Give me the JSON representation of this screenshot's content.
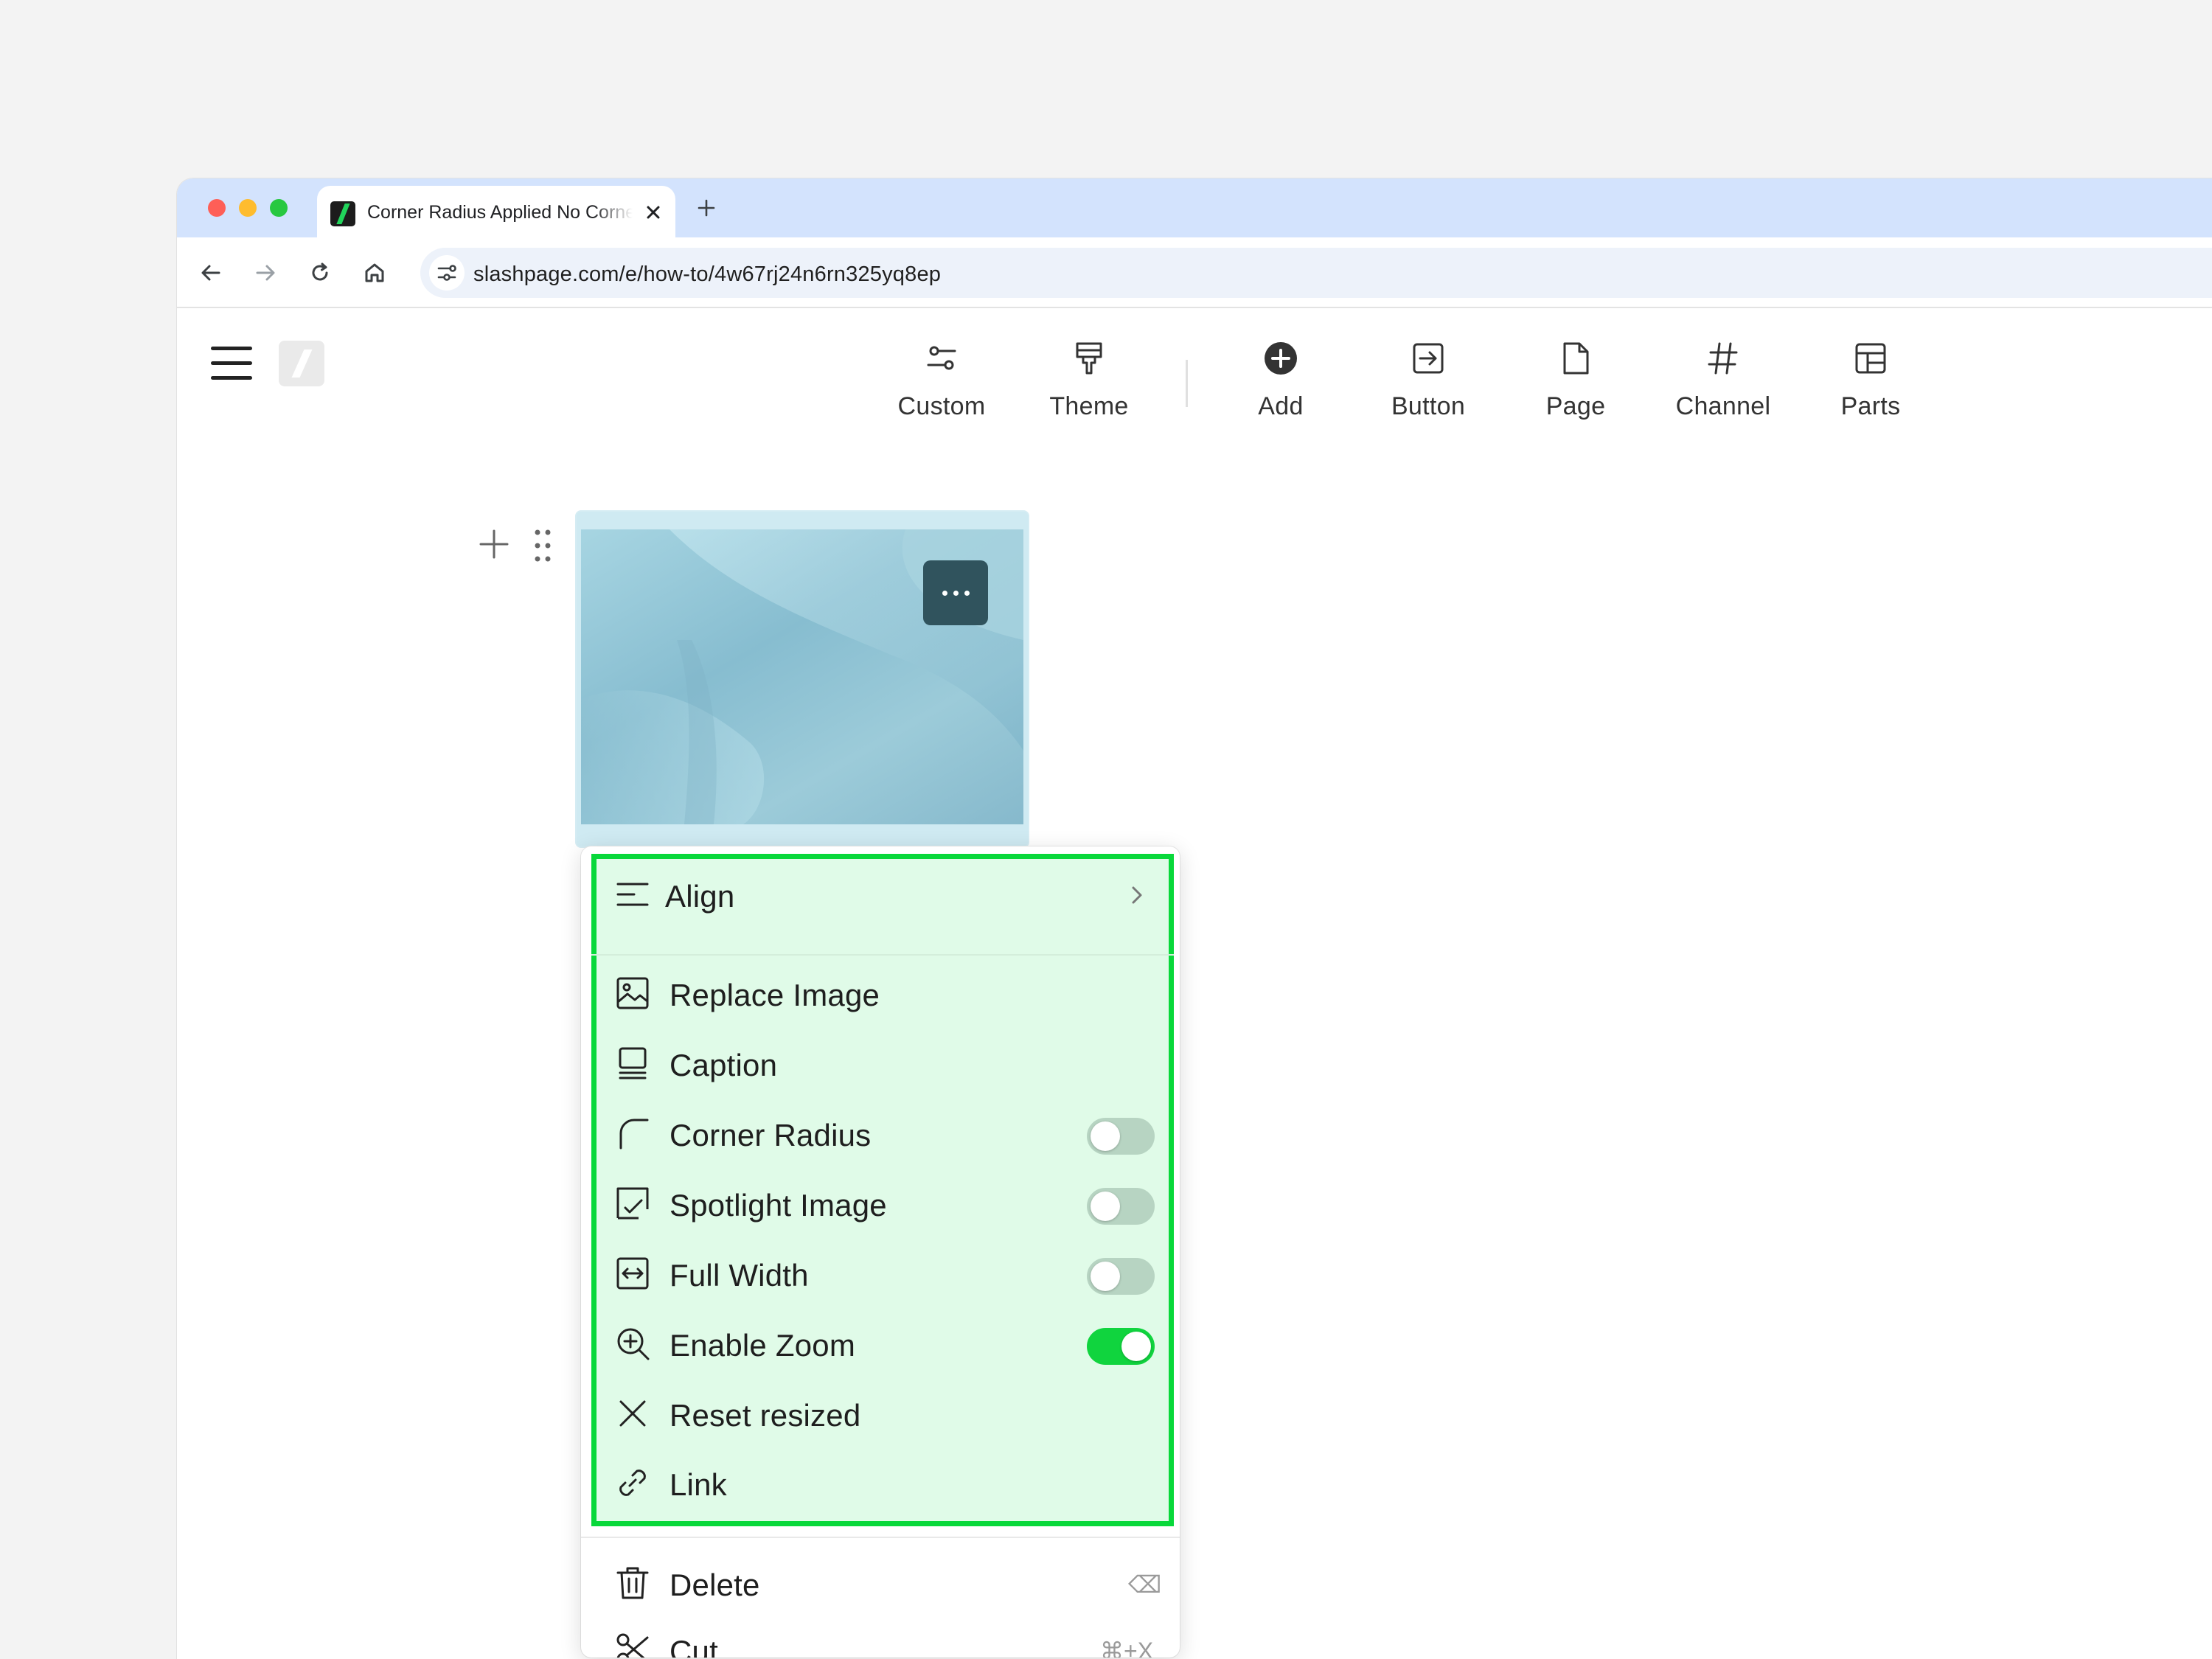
{
  "browser": {
    "tab_title": "Corner Radius Applied No Corner Radius",
    "url": "slashpage.com/e/how-to/4w67rj24n6rn325yq8ep",
    "traffic_light_colors": [
      "#fe5f57",
      "#febc2e",
      "#28c840"
    ]
  },
  "toolbar": {
    "items": [
      {
        "label": "Custom",
        "icon": "sliders-icon"
      },
      {
        "label": "Theme",
        "icon": "paint-roller-icon"
      },
      {
        "label": "Add",
        "icon": "plus-circle-icon"
      },
      {
        "label": "Button",
        "icon": "enter-box-icon"
      },
      {
        "label": "Page",
        "icon": "page-icon"
      },
      {
        "label": "Channel",
        "icon": "hash-icon"
      },
      {
        "label": "Parts",
        "icon": "layout-icon"
      }
    ]
  },
  "menu": {
    "align": "Align",
    "items": [
      {
        "label": "Replace Image",
        "icon": "image-icon"
      },
      {
        "label": "Caption",
        "icon": "caption-icon"
      },
      {
        "label": "Corner Radius",
        "icon": "corner-radius-icon",
        "toggle": false
      },
      {
        "label": "Spotlight Image",
        "icon": "spotlight-icon",
        "toggle": false
      },
      {
        "label": "Full Width",
        "icon": "full-width-icon",
        "toggle": false
      },
      {
        "label": "Enable Zoom",
        "icon": "zoom-in-icon",
        "toggle": true
      },
      {
        "label": "Reset resized",
        "icon": "close-icon"
      },
      {
        "label": "Link",
        "icon": "link-icon"
      }
    ],
    "delete": "Delete",
    "delete_shortcut": "⌫",
    "cut": "Cut",
    "cut_shortcut": "⌘+X"
  },
  "colors": {
    "highlight_border": "#08d83a",
    "highlight_fill": "#e0fbe8",
    "toggle_on": "#10d43e"
  }
}
